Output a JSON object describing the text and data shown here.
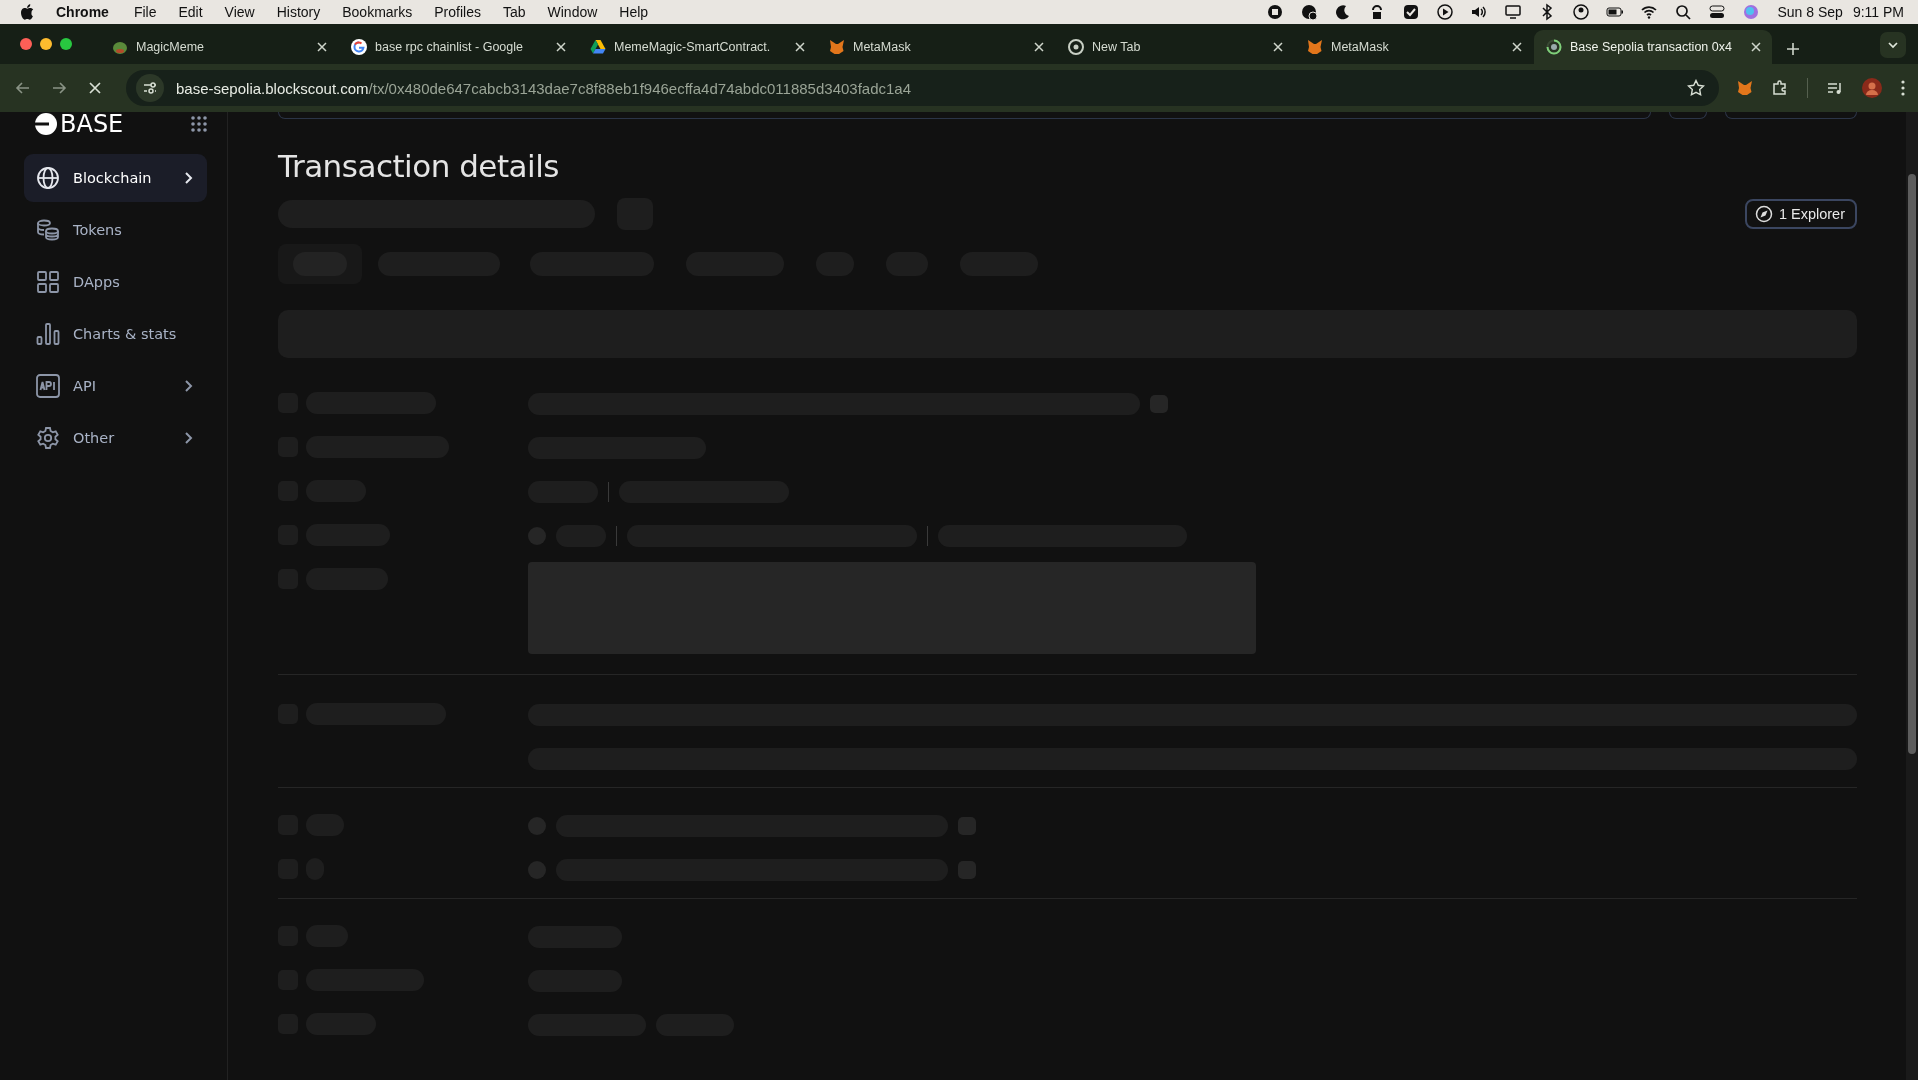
{
  "menu_bar": {
    "app": "Chrome",
    "items": [
      "File",
      "Edit",
      "View",
      "History",
      "Bookmarks",
      "Profiles",
      "Tab",
      "Window",
      "Help"
    ],
    "date": "Sun 8 Sep",
    "time": "9:11 PM"
  },
  "tabs": [
    {
      "title": "MagicMeme",
      "kind": "blob",
      "selected": false
    },
    {
      "title": "base rpc chainlist - Google",
      "kind": "google",
      "selected": false
    },
    {
      "title": "MemeMagic-SmartContract.",
      "kind": "drive",
      "selected": false
    },
    {
      "title": "MetaMask",
      "kind": "fox",
      "selected": false
    },
    {
      "title": "New Tab",
      "kind": "chrome",
      "selected": false
    },
    {
      "title": "MetaMask",
      "kind": "fox",
      "selected": false
    },
    {
      "title": "Base Sepolia transaction 0x4",
      "kind": "loading",
      "selected": true
    }
  ],
  "address_bar": {
    "url_host": "base-sepolia.blockscout.com",
    "url_path": "/tx/0x480de647cabcb3143dae7c8f88eb1f946ecffa4d74abdc011885d3403fadc1a4"
  },
  "sidebar": {
    "logo": "BASE",
    "items": [
      {
        "label": "Blockchain",
        "kind": "globe",
        "selected": true,
        "expandable": true
      },
      {
        "label": "Tokens",
        "kind": "coins",
        "selected": false,
        "expandable": false
      },
      {
        "label": "DApps",
        "kind": "grid",
        "selected": false,
        "expandable": false
      },
      {
        "label": "Charts & stats",
        "kind": "chart",
        "selected": false,
        "expandable": false
      },
      {
        "label": "API",
        "kind": "api",
        "selected": false,
        "expandable": true
      },
      {
        "label": "Other",
        "kind": "gear",
        "selected": false,
        "expandable": true
      }
    ]
  },
  "page": {
    "title": "Transaction details",
    "explorer_button": "1 Explorer"
  }
}
